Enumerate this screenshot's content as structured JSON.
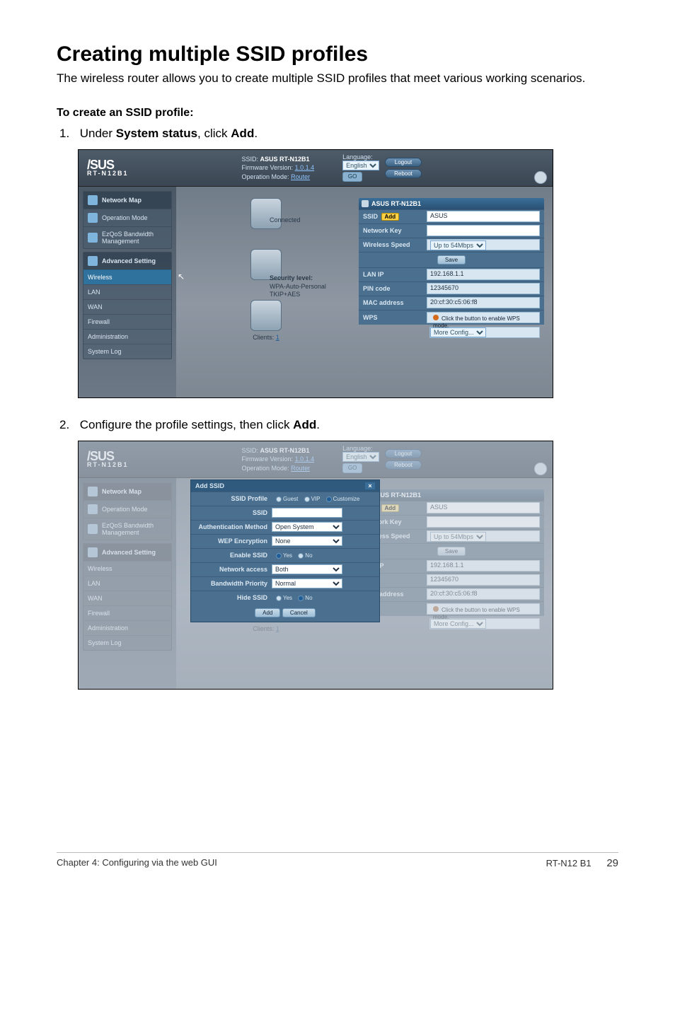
{
  "page": {
    "title": "Creating multiple SSID profiles",
    "intro": "The wireless router allows you to create multiple SSID profiles that meet various working scenarios.",
    "subhead": "To create an SSID profile:",
    "step1_pre": "Under ",
    "step1_b1": "System status",
    "step1_mid": ", click ",
    "step1_b2": "Add",
    "step1_post": ".",
    "step2_pre": "Configure the profile settings, then click ",
    "step2_b": "Add",
    "step2_post": "."
  },
  "footer": {
    "left": "Chapter 4: Configuring via the web GUI",
    "model": "RT-N12 B1",
    "page_no": "29"
  },
  "router": {
    "logo_top": "/SUS",
    "logo_sub": "RT-N12B1",
    "ssid_label": "SSID:",
    "ssid_value": "ASUS RT-N12B1",
    "fw_label": "Firmware Version:",
    "fw_value": "1.0.1.4",
    "opmode_label": "Operation Mode:",
    "opmode_value": "Router",
    "lang_label": "Language:",
    "lang_value": "English",
    "logout": "Logout",
    "reboot": "Reboot",
    "go": "GO",
    "side_full": [
      "Network Map",
      "Operation Mode",
      "EzQoS Bandwidth Management",
      "Advanced Setting",
      "Wireless",
      "LAN",
      "WAN",
      "Firewall",
      "Administration",
      "System Log"
    ],
    "connected": "Connected",
    "seclevel_title": "Security level:",
    "seclevel_l1": "WPA-Auto-Personal",
    "seclevel_l2": "TKIP+AES",
    "clients_label": "Clients:",
    "clients_n": "1",
    "status_hd": "ASUS RT-N12B1",
    "rows": {
      "ssid_l": "SSID",
      "ssid_add": "Add",
      "ssid_v": "ASUS",
      "netkey_l": "Network Key",
      "speed_l": "Wireless Speed",
      "speed_v": "Up to 54Mbps",
      "save": "Save",
      "lanip_l": "LAN IP",
      "lanip_v": "192.168.1.1",
      "pin_l": "PIN code",
      "pin_v": "12345670",
      "mac_l": "MAC address",
      "mac_v": "20:cf:30:c5:06:f8",
      "wps_l": "WPS",
      "wps_note": "Click the button to enable WPS mode.",
      "more": "More Config..."
    }
  },
  "modal": {
    "title": "Add SSID",
    "rows": {
      "profile_l": "SSID Profile",
      "profile_opts": [
        "Guest",
        "VIP",
        "Customize"
      ],
      "ssid_l": "SSID",
      "auth_l": "Authentication Method",
      "auth_v": "Open System",
      "wep_l": "WEP Encryption",
      "wep_v": "None",
      "enable_l": "Enable SSID",
      "enable_opts": [
        "Yes",
        "No"
      ],
      "access_l": "Network access",
      "access_v": "Both",
      "bw_l": "Bandwidth Priority",
      "bw_v": "Normal",
      "hide_l": "Hide SSID",
      "hide_opts": [
        "Yes",
        "No"
      ]
    },
    "add": "Add",
    "cancel": "Cancel"
  }
}
